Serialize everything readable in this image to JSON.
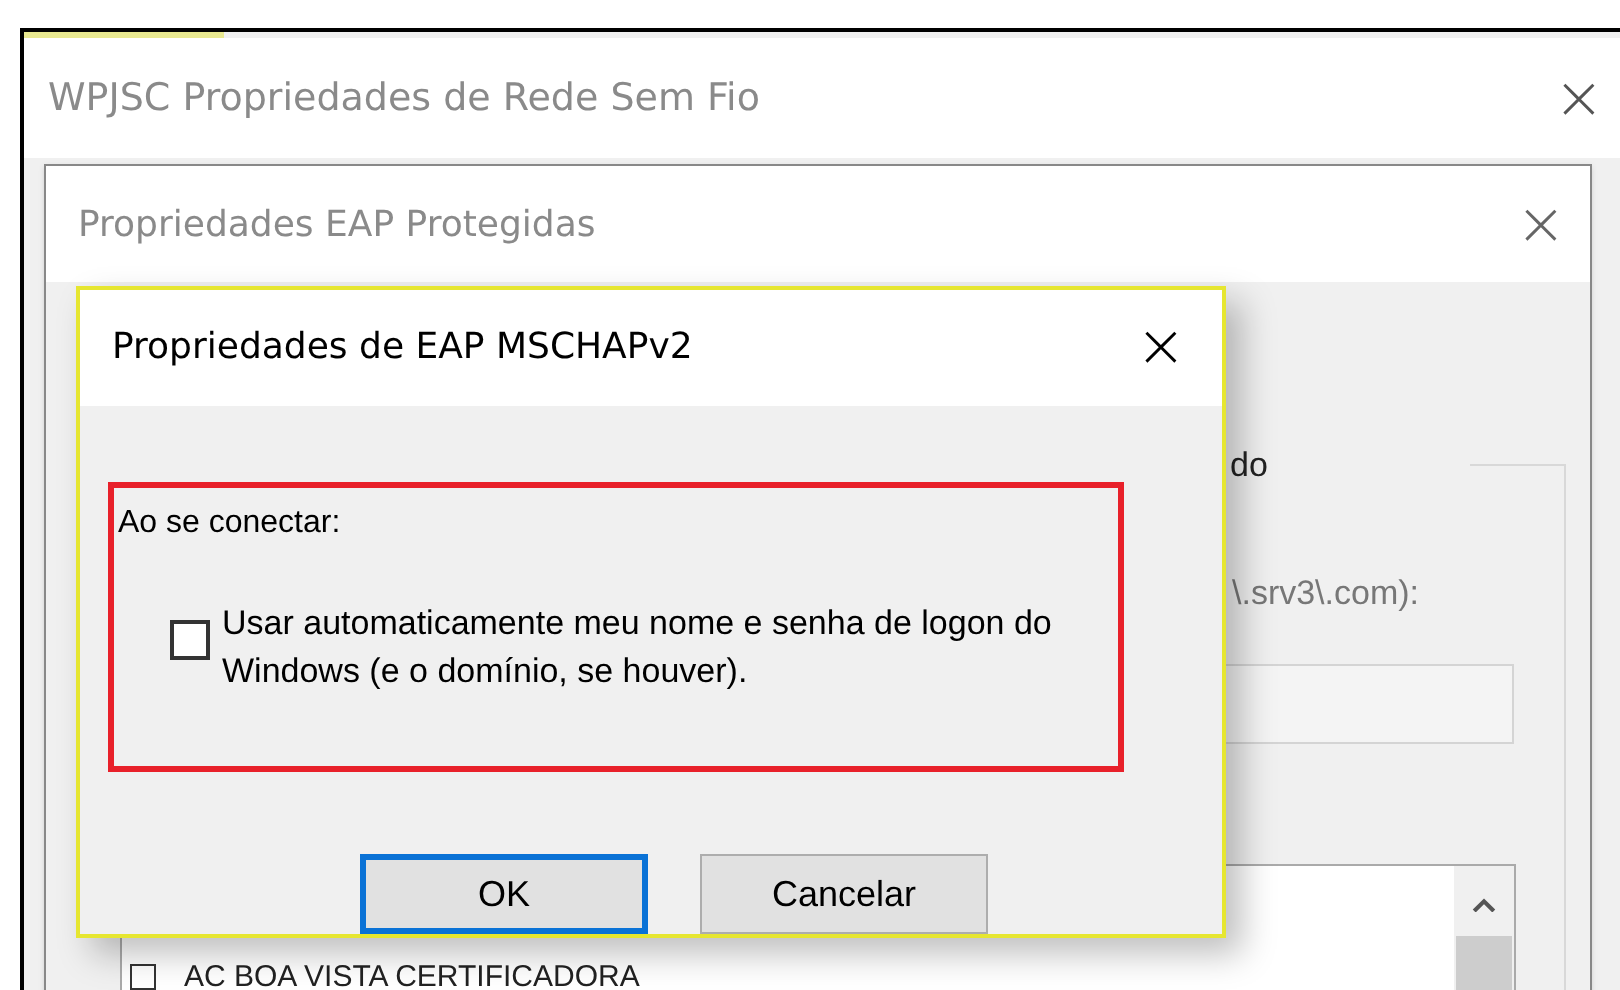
{
  "outer_window": {
    "title": "WPJSC Propriedades de Rede Sem Fio",
    "close": "×"
  },
  "middle_window": {
    "title": "Propriedades EAP Protegidas",
    "close": "×",
    "partial_label": "do",
    "server_suffix": "\\.srv3\\.com):",
    "certificate_items": [
      {
        "label": "AC BOA VISTA CERTIFICADORA",
        "checked": false
      }
    ]
  },
  "dialog": {
    "title": "Propriedades de EAP MSCHAPv2",
    "close": "×",
    "group_label": "Ao se conectar:",
    "checkbox": {
      "label": "Usar automaticamente meu nome e senha de logon do Windows (e o domínio, se houver).",
      "checked": false
    },
    "buttons": [
      {
        "label": "OK",
        "default": true
      },
      {
        "label": "Cancelar",
        "default": false
      }
    ]
  }
}
